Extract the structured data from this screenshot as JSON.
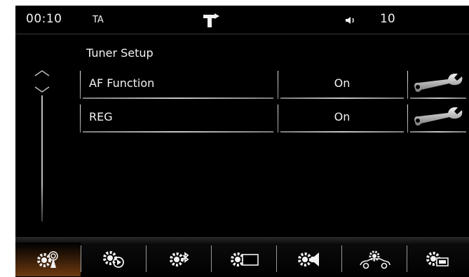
{
  "status": {
    "time": "00:10",
    "ta": "TA",
    "volume": "10"
  },
  "page": {
    "title": "Tuner Setup"
  },
  "settings": [
    {
      "label": "AF Function",
      "value": "On"
    },
    {
      "label": "REG",
      "value": "On"
    }
  ],
  "nav": {
    "tabs": [
      {
        "icon": "gear-radio-antenna-icon",
        "active": true
      },
      {
        "icon": "gear-play-icon",
        "active": false
      },
      {
        "icon": "gear-bluetooth-icon",
        "active": false
      },
      {
        "icon": "gear-screen-icon",
        "active": false
      },
      {
        "icon": "gear-speaker-icon",
        "active": false
      },
      {
        "icon": "gear-car-icon",
        "active": false
      },
      {
        "icon": "gear-display-icon",
        "active": false
      }
    ]
  },
  "colors": {
    "background": "#000000",
    "text": "#f2f2f2",
    "active_tab": "#6e3a10"
  }
}
